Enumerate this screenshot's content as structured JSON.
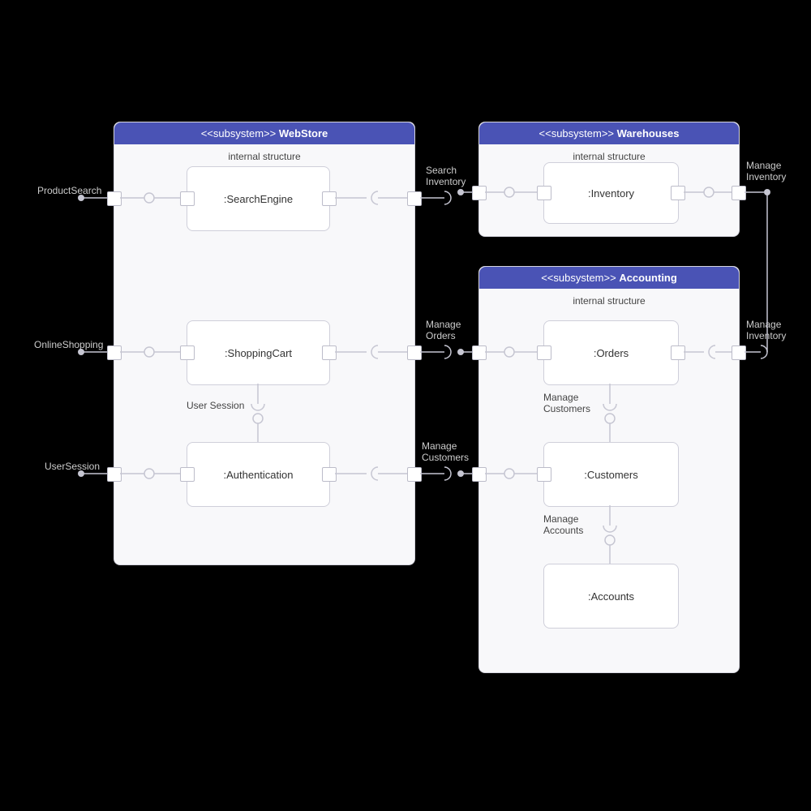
{
  "subsystems": {
    "webstore": {
      "stereotype": "<<subsystem>>",
      "name": "WebStore",
      "internal": "internal structure"
    },
    "warehouses": {
      "stereotype": "<<subsystem>>",
      "name": "Warehouses",
      "internal": "internal structure"
    },
    "accounting": {
      "stereotype": "<<subsystem>>",
      "name": "Accounting",
      "internal": "internal structure"
    }
  },
  "components": {
    "searchEngine": ":SearchEngine",
    "shoppingCart": ":ShoppingCart",
    "authentication": ":Authentication",
    "inventory": ":Inventory",
    "orders": ":Orders",
    "customers": ":Customers",
    "accounts": ":Accounts"
  },
  "labels": {
    "productSearch": "ProductSearch",
    "onlineShopping": "OnlineShopping",
    "userSession": "UserSession",
    "userSessionInner": "User Session",
    "searchInventory": "Search\nInventory",
    "manageOrders": "Manage\nOrders",
    "manageCustomers": "Manage\nCustomers",
    "manageCustomersInner": "Manage\nCustomers",
    "manageAccounts": "Manage\nAccounts",
    "manageInventory": "Manage\nInventory",
    "manageInventory2": "Manage\nInventory"
  }
}
